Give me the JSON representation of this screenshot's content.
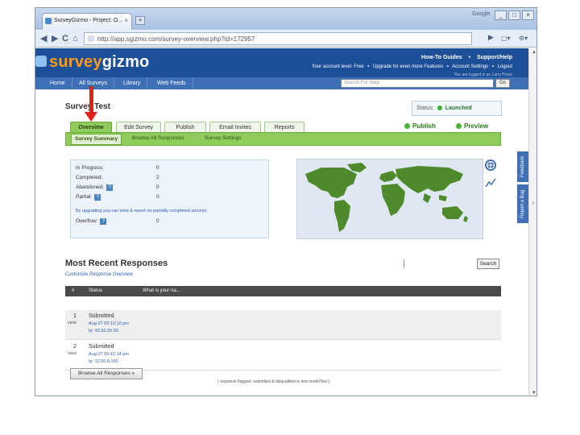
{
  "browser": {
    "tab_title": "SurveyGizmo - Project: O...",
    "tab_close": "×",
    "new_tab": "+",
    "brand": "Google",
    "window_buttons": [
      "_",
      "□",
      "×"
    ],
    "back": "◀",
    "forward": "▶",
    "reload": "C",
    "home": "⌂",
    "url": "http://app.sgizmo.com/survey-overview.php?id=172957",
    "go_icon": "▶",
    "page_menu": "▢▾",
    "tools_menu": "⚙▾"
  },
  "header": {
    "logo_part1": "survey",
    "logo_part2": "gizmo",
    "link_guides": "How-To Guides",
    "link_support": "Support/Help",
    "account_level": "Your account level: Free",
    "link_upgrade": "Upgrade for even more Features",
    "link_settings": "Account Settings",
    "link_logout": "Logout",
    "logged_in": "You are logged in as Larry Press",
    "separator": "•"
  },
  "nav": {
    "items": [
      "Home",
      "All Surveys",
      "Library",
      "Web Feeds"
    ],
    "search_placeholder": "Search For Help",
    "go_label": "Go"
  },
  "side_tabs": [
    "Feedback",
    "Report a Bug"
  ],
  "scrollbar": {
    "up": "▲",
    "down": "▼",
    "grip": "≡"
  },
  "survey": {
    "title": "Survey Test",
    "status_label": "Status:",
    "status_value": "Launched",
    "tabs": [
      "Overview",
      "Edit Survey",
      "Publish",
      "Email Invites",
      "Reports"
    ],
    "subtabs": [
      "Survey Summary",
      "Browse All Responses",
      "Survey Settings"
    ],
    "publish_label": "Publish",
    "preview_label": "Preview"
  },
  "stats": {
    "rows": [
      {
        "label": "In Progress:",
        "value": "0"
      },
      {
        "label": "Completed:",
        "value": "2"
      },
      {
        "label": "Abandoned:",
        "value": "0"
      },
      {
        "label": "Partial:",
        "value": "0"
      }
    ],
    "upgrade_note": "By upgrading you can view & report on partially completed surveys.",
    "overflow_label": "Overflow:",
    "overflow_value": "0",
    "help_mark": "?"
  },
  "recent": {
    "title": "Most Recent Responses",
    "customize_link": "Customize Response Overview",
    "search_label": "Search",
    "columns": [
      "#",
      "Status",
      "What is your na..."
    ],
    "rows": [
      {
        "num": "1",
        "view": "view",
        "status": "Submitted",
        "date": "Aug-27 00:12:10 pm",
        "ip": "Ip: 42.50.20.50"
      },
      {
        "num": "2",
        "view": "view",
        "status": "Submitted",
        "date": "Aug-27 00:12:14 pm",
        "ip": "Ip: 12.50.8.150"
      }
    ],
    "browse_all": "Browse All Responses »",
    "legend": "( response flagged: submitted & disqualified in test mode/Test )"
  },
  "colors": {
    "header_blue": "#1c4f98",
    "accent_orange": "#ff9a1a",
    "tab_green": "#8fcb5b",
    "arrow_red": "#e0201c"
  }
}
